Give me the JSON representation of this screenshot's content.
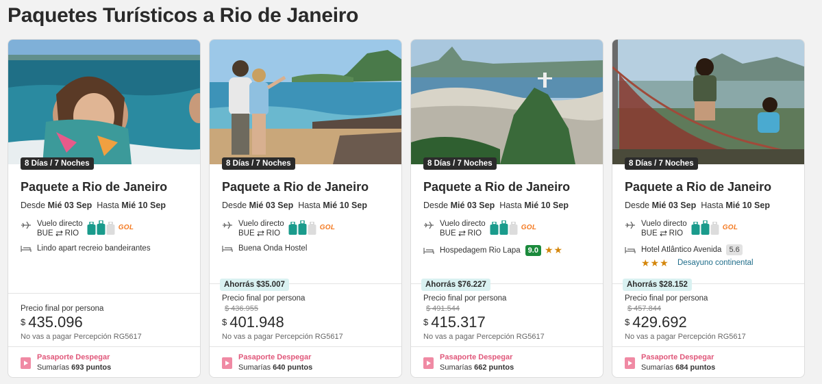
{
  "page": {
    "title": "Paquetes Turísticos a Rio de Janeiro"
  },
  "colors": {
    "accent_pink": "#e0577a",
    "rating_green": "#1b8a3c",
    "savings_bg": "#d9f1f1",
    "bag_teal": "#1a9b8c",
    "gol_orange": "#f47920",
    "star_gold": "#d4860b"
  },
  "icons": [
    "plane-icon",
    "bag-icon",
    "bed-icon",
    "passport-icon",
    "star-icon",
    "round-trip-arrows-icon"
  ],
  "cards": [
    {
      "badge": "8 Días / 7 Noches",
      "title": "Paquete a Rio de Janeiro",
      "desde_label": "Desde",
      "desde_date": "Mié 03 Sep",
      "hasta_label": "Hasta",
      "hasta_date": "Mié 10 Sep",
      "flight_label": "Vuelo directo",
      "origin": "BUE",
      "destination": "RIO",
      "airline": "GOL",
      "hotel": "Lindo apart recreio bandeirantes",
      "savings": "",
      "price_label": "Precio final por persona",
      "old_price": "",
      "currency": "$",
      "price": "435.096",
      "perception": "No vas a pagar Percepción RG5617",
      "passport_title": "Pasaporte Despegar",
      "points_prefix": "Sumarías",
      "points": "693 puntos"
    },
    {
      "badge": "8 Días / 7 Noches",
      "title": "Paquete a Rio de Janeiro",
      "desde_label": "Desde",
      "desde_date": "Mié 03 Sep",
      "hasta_label": "Hasta",
      "hasta_date": "Mié 10 Sep",
      "flight_label": "Vuelo directo",
      "origin": "BUE",
      "destination": "RIO",
      "airline": "GOL",
      "hotel": "Buena Onda Hostel",
      "savings": "Ahorrás $35.007",
      "price_label": "Precio final por persona",
      "old_price": "$ 436.955",
      "currency": "$",
      "price": "401.948",
      "perception": "No vas a pagar Percepción RG5617",
      "passport_title": "Pasaporte Despegar",
      "points_prefix": "Sumarías",
      "points": "640 puntos"
    },
    {
      "badge": "8 Días / 7 Noches",
      "title": "Paquete a Rio de Janeiro",
      "desde_label": "Desde",
      "desde_date": "Mié 03 Sep",
      "hasta_label": "Hasta",
      "hasta_date": "Mié 10 Sep",
      "flight_label": "Vuelo directo",
      "origin": "BUE",
      "destination": "RIO",
      "airline": "GOL",
      "hotel": "Hospedagem Rio Lapa",
      "rating": "9.0",
      "stars": 2,
      "savings": "Ahorrás $76.227",
      "price_label": "Precio final por persona",
      "old_price": "$ 491.544",
      "currency": "$",
      "price": "415.317",
      "perception": "No vas a pagar Percepción RG5617",
      "passport_title": "Pasaporte Despegar",
      "points_prefix": "Sumarías",
      "points": "662 puntos"
    },
    {
      "badge": "8 Días / 7 Noches",
      "title": "Paquete a Rio de Janeiro",
      "desde_label": "Desde",
      "desde_date": "Mié 03 Sep",
      "hasta_label": "Hasta",
      "hasta_date": "Mié 10 Sep",
      "flight_label": "Vuelo directo",
      "origin": "BUE",
      "destination": "RIO",
      "airline": "GOL",
      "hotel": "Hotel Atlântico Avenida",
      "rating": "5.6",
      "stars": 3,
      "meal": "Desayuno continental",
      "savings": "Ahorrás $28.152",
      "price_label": "Precio final por persona",
      "old_price": "$ 457.844",
      "currency": "$",
      "price": "429.692",
      "perception": "No vas a pagar Percepción RG5617",
      "passport_title": "Pasaporte Despegar",
      "points_prefix": "Sumarías",
      "points": "684 puntos"
    }
  ]
}
